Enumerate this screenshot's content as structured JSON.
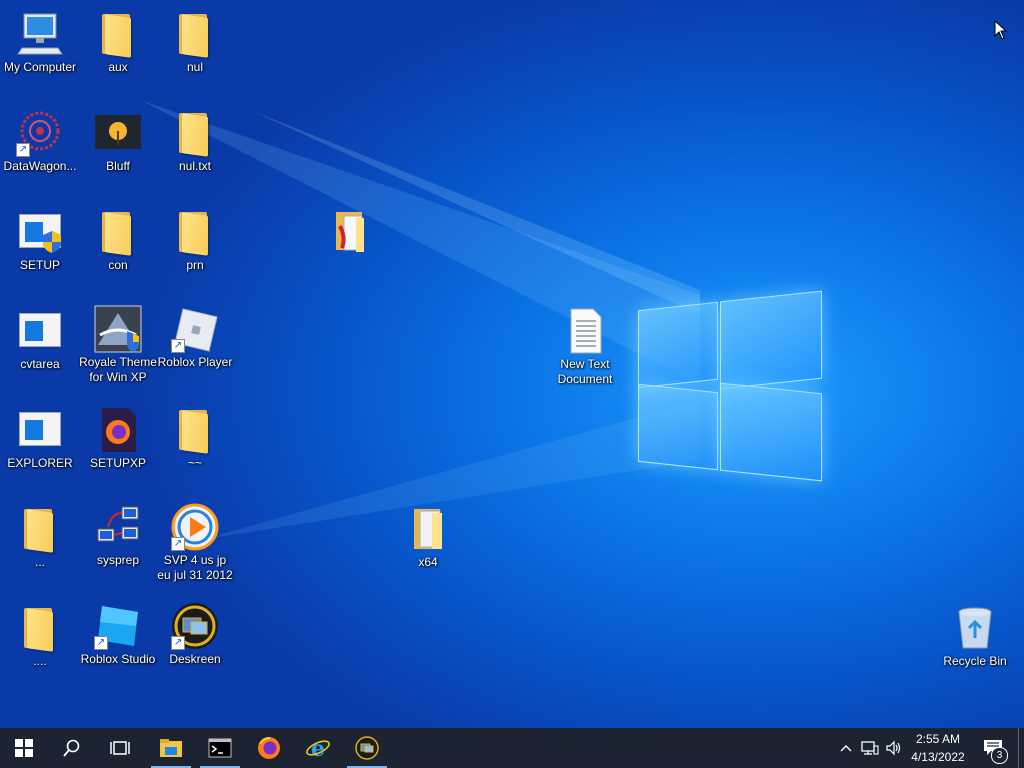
{
  "desktop": {
    "icons": [
      {
        "label": "My Computer"
      },
      {
        "label": "aux"
      },
      {
        "label": "nul"
      },
      {
        "label": "DataWagon..."
      },
      {
        "label": "Bluff"
      },
      {
        "label": "nul.txt"
      },
      {
        "label": "SETUP"
      },
      {
        "label": "con"
      },
      {
        "label": "prn"
      },
      {
        "label": "cvtarea"
      },
      {
        "label": "Royale Theme for Win XP"
      },
      {
        "label": "Roblox Player"
      },
      {
        "label": "EXPLORER"
      },
      {
        "label": "SETUPXP"
      },
      {
        "label": "~~"
      },
      {
        "label": "..."
      },
      {
        "label": "sysprep"
      },
      {
        "label": "SVP 4 us jp eu jul 31 2012"
      },
      {
        "label": "...."
      },
      {
        "label": "Roblox Studio"
      },
      {
        "label": "Deskreen"
      },
      {
        "label": "New Text Document"
      },
      {
        "label": "x64"
      },
      {
        "label": "Recycle Bin"
      }
    ]
  },
  "taskbar": {
    "clock_time": "2:55 AM",
    "clock_date": "4/13/2022",
    "notification_count": "3"
  },
  "colors": {
    "taskbar_bg": "#1b2430",
    "desktop_accent": "#0a74e6",
    "folder": "#f6cc58"
  }
}
